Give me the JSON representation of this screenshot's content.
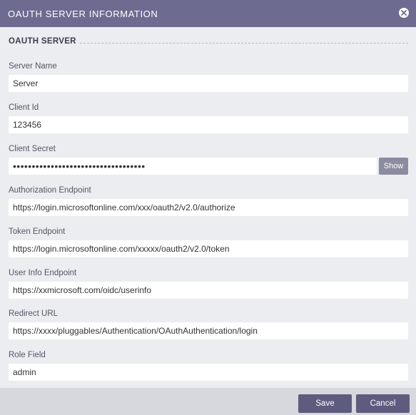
{
  "dialog": {
    "title": "OAUTH SERVER INFORMATION",
    "close_icon": "close-circle-icon"
  },
  "section": {
    "title": "OAUTH SERVER"
  },
  "fields": {
    "server_name": {
      "label": "Server Name",
      "value": "Server"
    },
    "client_id": {
      "label": "Client Id",
      "value": "123456"
    },
    "client_secret": {
      "label": "Client Secret",
      "value": "•••••••••••••••••••••••••••••••••••",
      "show_label": "Show"
    },
    "authorization_endpoint": {
      "label": "Authorization Endpoint",
      "value": "https://login.microsoftonline.com/xxx/oauth2/v2.0/authorize"
    },
    "token_endpoint": {
      "label": "Token Endpoint",
      "value": "https://login.microsoftonline.com/xxxxx/oauth2/v2.0/token"
    },
    "user_info_endpoint": {
      "label": "User Info Endpoint",
      "value": "https://xxmicrosoft.com/oidc/userinfo"
    },
    "redirect_url": {
      "label": "Redirect URL",
      "value": "https://xxxx/pluggables/Authentication/OAuthAuthentication/login"
    },
    "role_field": {
      "label": "Role Field",
      "value": "admin"
    }
  },
  "footer": {
    "save_label": "Save",
    "cancel_label": "Cancel"
  },
  "colors": {
    "titlebar": "#6d6b8f",
    "body": "#ecedf1",
    "footer": "#d7d8de",
    "primary_button": "#5d5b7e",
    "show_button": "#8c8ca0"
  }
}
